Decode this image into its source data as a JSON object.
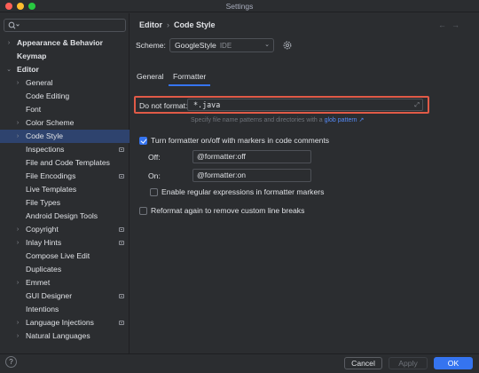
{
  "window": {
    "title": "Settings"
  },
  "sidebar": {
    "search_placeholder": "",
    "items": [
      {
        "label": "Appearance & Behavior",
        "bold": true,
        "chevron": "›",
        "level": 0
      },
      {
        "label": "Keymap",
        "bold": true,
        "chevron": "",
        "level": 0
      },
      {
        "label": "Editor",
        "bold": true,
        "chevron": "⌄",
        "level": 0
      },
      {
        "label": "General",
        "chevron": "›",
        "level": 1
      },
      {
        "label": "Code Editing",
        "chevron": "",
        "level": 1
      },
      {
        "label": "Font",
        "chevron": "",
        "level": 1
      },
      {
        "label": "Color Scheme",
        "chevron": "›",
        "level": 1
      },
      {
        "label": "Code Style",
        "chevron": "›",
        "level": 1,
        "selected": true
      },
      {
        "label": "Inspections",
        "chevron": "",
        "level": 1,
        "badge": true
      },
      {
        "label": "File and Code Templates",
        "chevron": "",
        "level": 1
      },
      {
        "label": "File Encodings",
        "chevron": "",
        "level": 1,
        "badge": true
      },
      {
        "label": "Live Templates",
        "chevron": "",
        "level": 1
      },
      {
        "label": "File Types",
        "chevron": "",
        "level": 1
      },
      {
        "label": "Android Design Tools",
        "chevron": "",
        "level": 1
      },
      {
        "label": "Copyright",
        "chevron": "›",
        "level": 1,
        "badge": true
      },
      {
        "label": "Inlay Hints",
        "chevron": "›",
        "level": 1,
        "badge": true
      },
      {
        "label": "Compose Live Edit",
        "chevron": "",
        "level": 1
      },
      {
        "label": "Duplicates",
        "chevron": "",
        "level": 1
      },
      {
        "label": "Emmet",
        "chevron": "›",
        "level": 1
      },
      {
        "label": "GUI Designer",
        "chevron": "",
        "level": 1,
        "badge": true
      },
      {
        "label": "Intentions",
        "chevron": "",
        "level": 1
      },
      {
        "label": "Language Injections",
        "chevron": "›",
        "level": 1,
        "badge": true
      },
      {
        "label": "Natural Languages",
        "chevron": "›",
        "level": 1
      }
    ]
  },
  "breadcrumb": {
    "parent": "Editor",
    "separator": "›",
    "current": "Code Style"
  },
  "scheme": {
    "label": "Scheme:",
    "value": "GoogleStyle",
    "suffix": "IDE"
  },
  "tabs": [
    {
      "label": "General",
      "active": false
    },
    {
      "label": "Formatter",
      "active": true
    }
  ],
  "formatter": {
    "do_not_format_label": "Do not format:",
    "do_not_format_value": "*.java",
    "hint_text": "Specify file name patterns and directories with a",
    "hint_link": "glob pattern ↗",
    "toggle_markers_label": "Turn formatter on/off with markers in code comments",
    "toggle_markers_checked": true,
    "off_label": "Off:",
    "off_value": "@formatter:off",
    "on_label": "On:",
    "on_value": "@formatter:on",
    "regex_label": "Enable regular expressions in formatter markers",
    "regex_checked": false,
    "reformat_label": "Reformat again to remove custom line breaks",
    "reformat_checked": false
  },
  "footer": {
    "help": "?",
    "cancel": "Cancel",
    "apply": "Apply",
    "ok": "OK"
  },
  "colors": {
    "accent": "#3574f0",
    "highlight_border": "#e05a47",
    "selected_row": "#2e436e",
    "link": "#548af7"
  }
}
